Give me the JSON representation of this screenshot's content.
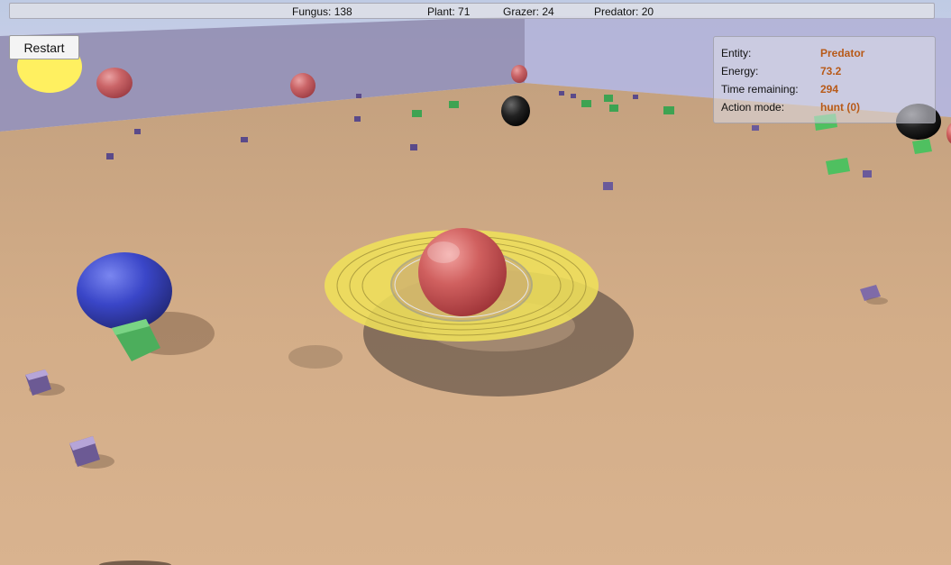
{
  "stats": {
    "fungus": "Fungus: 138",
    "plant": "Plant: 71",
    "grazer": "Grazer: 24",
    "predator": "Predator: 20"
  },
  "restart_label": "Restart",
  "info": {
    "entity_label": "Entity:",
    "entity_value": "Predator",
    "energy_label": "Energy:",
    "energy_value": "73.2",
    "time_label": "Time remaining:",
    "time_value": "294",
    "mode_label": "Action mode:",
    "mode_value": "hunt (0)"
  },
  "colors": {
    "ground": "#d3ad88",
    "sky": "#c9cde6",
    "wall": "#a6a3c8",
    "predator": "#c24a4e",
    "grazer": "#3a46c8",
    "plant": "#4fc060",
    "fungus": "#7f6ba8",
    "selection_ring": "#efe05a",
    "sun": "#fff060",
    "value_text": "#b85a18"
  },
  "icons": {
    "selection": "selection-ring-icon",
    "sun": "sun-icon"
  }
}
